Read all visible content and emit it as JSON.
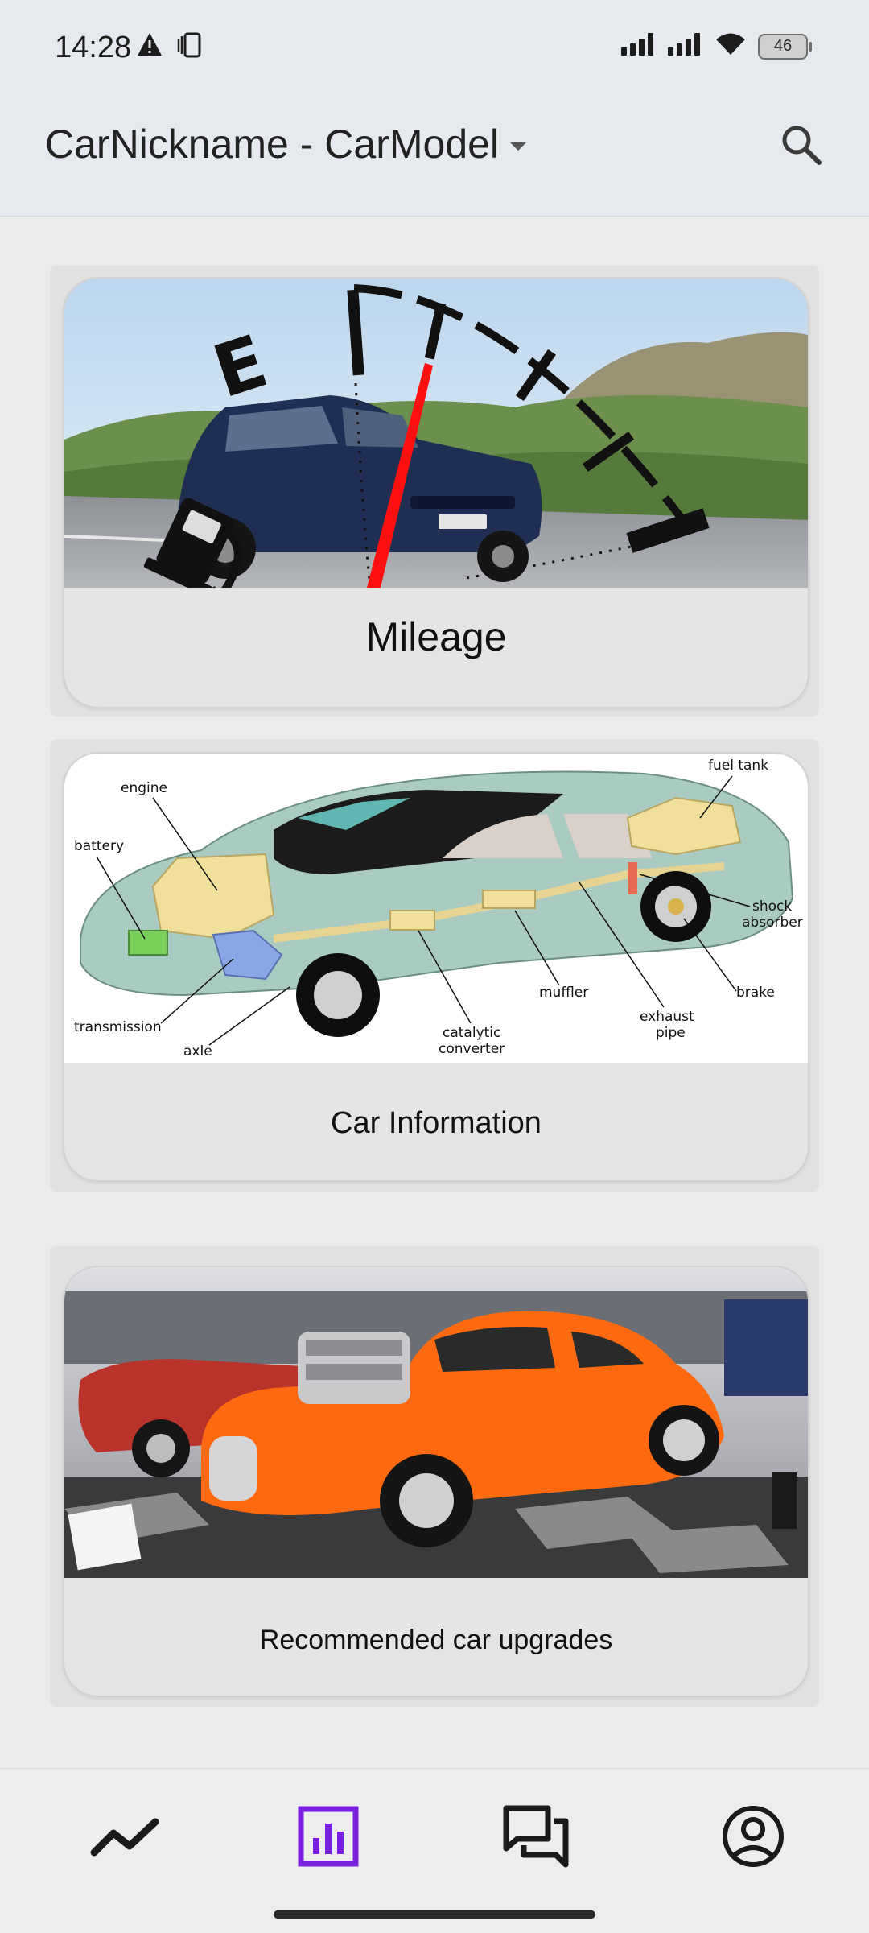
{
  "status_bar": {
    "time": "14:28",
    "battery": "46",
    "icons": [
      "alert-icon",
      "vibrate-icon",
      "signal-icon",
      "signal-icon",
      "wifi-icon",
      "battery-icon"
    ]
  },
  "app_bar": {
    "title": "CarNickname - CarModel",
    "title_dropdown_icon": "caret-down-icon",
    "search_icon": "search-icon"
  },
  "cards": [
    {
      "label": "Mileage",
      "image": "fuel-gauge-photo"
    },
    {
      "label": "Car Information",
      "image": "car-cutaway-diagram",
      "diagram_labels": {
        "engine": "engine",
        "battery": "battery",
        "transmission": "transmission",
        "axle": "axle",
        "catalytic": "catalytic",
        "converter": "converter",
        "muffler": "muffler",
        "exhaust": "exhaust",
        "pipe": "pipe",
        "brake": "brake",
        "shock": "shock",
        "absorber": "absorber",
        "fuel_tank": "fuel tank"
      }
    },
    {
      "label": "Recommended car upgrades",
      "image": "orange-hot-rod-photo"
    }
  ],
  "gauge": {
    "letter": "E"
  },
  "bottom_nav": {
    "items": [
      {
        "name": "trends",
        "icon": "trend-line-icon",
        "active": false
      },
      {
        "name": "stats",
        "icon": "bar-chart-icon",
        "active": true
      },
      {
        "name": "chat",
        "icon": "chat-bubbles-icon",
        "active": false
      },
      {
        "name": "profile",
        "icon": "account-circle-icon",
        "active": false
      }
    ]
  },
  "colors": {
    "active_nav": "#7a1fe0",
    "icon": "#1a1a1a",
    "background": "#ebebeb",
    "car_orange": "#ff6a10"
  }
}
